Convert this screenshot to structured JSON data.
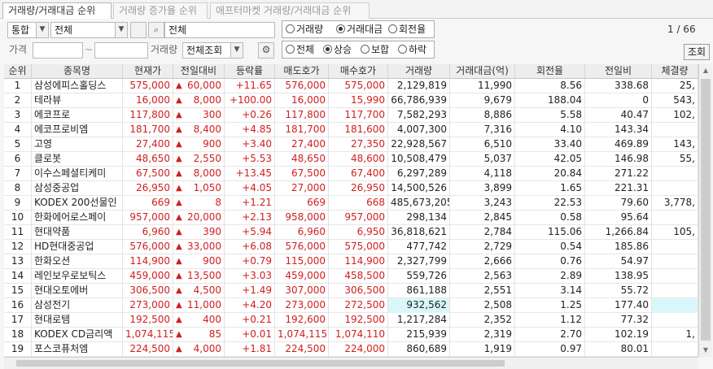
{
  "tabs": [
    "거래량/거래대금 순위",
    "거래량 증가율 순위",
    "애프터마켓 거래량/거래대금 순위"
  ],
  "filters": {
    "market": "통합",
    "category": "전체",
    "stock_field": "전체",
    "price_label": "가격",
    "price_from": "",
    "tilde": "~",
    "price_to": "",
    "volume_label": "거래량",
    "volume_option": "전체조회"
  },
  "sort_options": [
    "거래량",
    "거래대금",
    "회전율"
  ],
  "sort_selected": "거래대금",
  "updown_options": [
    "전체",
    "상승",
    "보합",
    "하락"
  ],
  "updown_selected": "상승",
  "page_indicator": "1 / 66",
  "search_button": "조회",
  "icons": {
    "search": "search-icon",
    "settings": "gear-icon",
    "dropdown": "chevron-down-icon"
  },
  "colors": {
    "up": "#d21e1e",
    "highlight": "#d9f7fb"
  },
  "columns": [
    "순위",
    "종목명",
    "현재가",
    "전일대비",
    "등락률",
    "매도호가",
    "매수호가",
    "거래량",
    "거래대금(억)",
    "회전율",
    "전일비",
    "체결량"
  ],
  "rows": [
    {
      "rank": "1",
      "name": "삼성에피스홀딩스",
      "price": "575,000",
      "change": "60,000",
      "rate": "+11.65",
      "ask": "576,000",
      "bid": "575,000",
      "volume": "2,129,819",
      "amount": "11,990",
      "turnover": "8.56",
      "prev": "338.68",
      "exec": "25,"
    },
    {
      "rank": "2",
      "name": "테라뷰",
      "price": "16,000",
      "change": "8,000",
      "rate": "+100.00",
      "ask": "16,000",
      "bid": "15,990",
      "volume": "66,786,939",
      "amount": "9,679",
      "turnover": "188.04",
      "prev": "0",
      "exec": "543,"
    },
    {
      "rank": "3",
      "name": "에코프로",
      "price": "117,800",
      "change": "300",
      "rate": "+0.26",
      "ask": "117,800",
      "bid": "117,700",
      "volume": "7,582,293",
      "amount": "8,886",
      "turnover": "5.58",
      "prev": "40.47",
      "exec": "102,"
    },
    {
      "rank": "4",
      "name": "에코프로비엠",
      "price": "181,700",
      "change": "8,400",
      "rate": "+4.85",
      "ask": "181,700",
      "bid": "181,600",
      "volume": "4,007,300",
      "amount": "7,316",
      "turnover": "4.10",
      "prev": "143.34",
      "exec": ""
    },
    {
      "rank": "5",
      "name": "고영",
      "price": "27,400",
      "change": "900",
      "rate": "+3.40",
      "ask": "27,400",
      "bid": "27,350",
      "volume": "22,928,567",
      "amount": "6,510",
      "turnover": "33.40",
      "prev": "469.89",
      "exec": "143,"
    },
    {
      "rank": "6",
      "name": "클로봇",
      "price": "48,650",
      "change": "2,550",
      "rate": "+5.53",
      "ask": "48,650",
      "bid": "48,600",
      "volume": "10,508,479",
      "amount": "5,037",
      "turnover": "42.05",
      "prev": "146.98",
      "exec": "55,"
    },
    {
      "rank": "7",
      "name": "이수스페셜티케미",
      "price": "67,500",
      "change": "8,000",
      "rate": "+13.45",
      "ask": "67,500",
      "bid": "67,400",
      "volume": "6,297,289",
      "amount": "4,118",
      "turnover": "20.84",
      "prev": "271.22",
      "exec": ""
    },
    {
      "rank": "8",
      "name": "삼성중공업",
      "price": "26,950",
      "change": "1,050",
      "rate": "+4.05",
      "ask": "27,000",
      "bid": "26,950",
      "volume": "14,500,526",
      "amount": "3,899",
      "turnover": "1.65",
      "prev": "221.31",
      "exec": ""
    },
    {
      "rank": "9",
      "name": "KODEX 200선물인",
      "price": "669",
      "change": "8",
      "rate": "+1.21",
      "ask": "669",
      "bid": "668",
      "volume": "485,673,205",
      "amount": "3,243",
      "turnover": "22.53",
      "prev": "79.60",
      "exec": "3,778,"
    },
    {
      "rank": "10",
      "name": "한화에어로스페이",
      "price": "957,000",
      "change": "20,000",
      "rate": "+2.13",
      "ask": "958,000",
      "bid": "957,000",
      "volume": "298,134",
      "amount": "2,845",
      "turnover": "0.58",
      "prev": "95.64",
      "exec": ""
    },
    {
      "rank": "11",
      "name": "현대약품",
      "price": "6,960",
      "change": "390",
      "rate": "+5.94",
      "ask": "6,960",
      "bid": "6,950",
      "volume": "36,818,621",
      "amount": "2,784",
      "turnover": "115.06",
      "prev": "1,266.84",
      "exec": "105,"
    },
    {
      "rank": "12",
      "name": "HD현대중공업",
      "price": "576,000",
      "change": "33,000",
      "rate": "+6.08",
      "ask": "576,000",
      "bid": "575,000",
      "volume": "477,742",
      "amount": "2,729",
      "turnover": "0.54",
      "prev": "185.86",
      "exec": ""
    },
    {
      "rank": "13",
      "name": "한화오션",
      "price": "114,900",
      "change": "900",
      "rate": "+0.79",
      "ask": "115,000",
      "bid": "114,900",
      "volume": "2,327,799",
      "amount": "2,666",
      "turnover": "0.76",
      "prev": "54.97",
      "exec": ""
    },
    {
      "rank": "14",
      "name": "레인보우로보틱스",
      "price": "459,000",
      "change": "13,500",
      "rate": "+3.03",
      "ask": "459,000",
      "bid": "458,500",
      "volume": "559,726",
      "amount": "2,563",
      "turnover": "2.89",
      "prev": "138.95",
      "exec": ""
    },
    {
      "rank": "15",
      "name": "현대오토에버",
      "price": "306,500",
      "change": "4,500",
      "rate": "+1.49",
      "ask": "307,000",
      "bid": "306,500",
      "volume": "861,188",
      "amount": "2,551",
      "turnover": "3.14",
      "prev": "55.72",
      "exec": ""
    },
    {
      "rank": "16",
      "name": "삼성전기",
      "price": "273,000",
      "change": "11,000",
      "rate": "+4.20",
      "ask": "273,000",
      "bid": "272,500",
      "volume": "932,562",
      "amount": "2,508",
      "turnover": "1.25",
      "prev": "177.40",
      "exec": ""
    },
    {
      "rank": "17",
      "name": "현대로템",
      "price": "192,500",
      "change": "400",
      "rate": "+0.21",
      "ask": "192,600",
      "bid": "192,500",
      "volume": "1,217,284",
      "amount": "2,352",
      "turnover": "1.12",
      "prev": "77.32",
      "exec": ""
    },
    {
      "rank": "18",
      "name": "KODEX CD금리액",
      "price": "1,074,115",
      "change": "85",
      "rate": "+0.01",
      "ask": "1,074,115",
      "bid": "1,074,110",
      "volume": "215,939",
      "amount": "2,319",
      "turnover": "2.70",
      "prev": "102.19",
      "exec": "1,"
    },
    {
      "rank": "19",
      "name": "포스코퓨처엠",
      "price": "224,500",
      "change": "4,000",
      "rate": "+1.81",
      "ask": "224,500",
      "bid": "224,000",
      "volume": "860,689",
      "amount": "1,919",
      "turnover": "0.97",
      "prev": "80.01",
      "exec": ""
    }
  ],
  "up_arrow": "▲"
}
